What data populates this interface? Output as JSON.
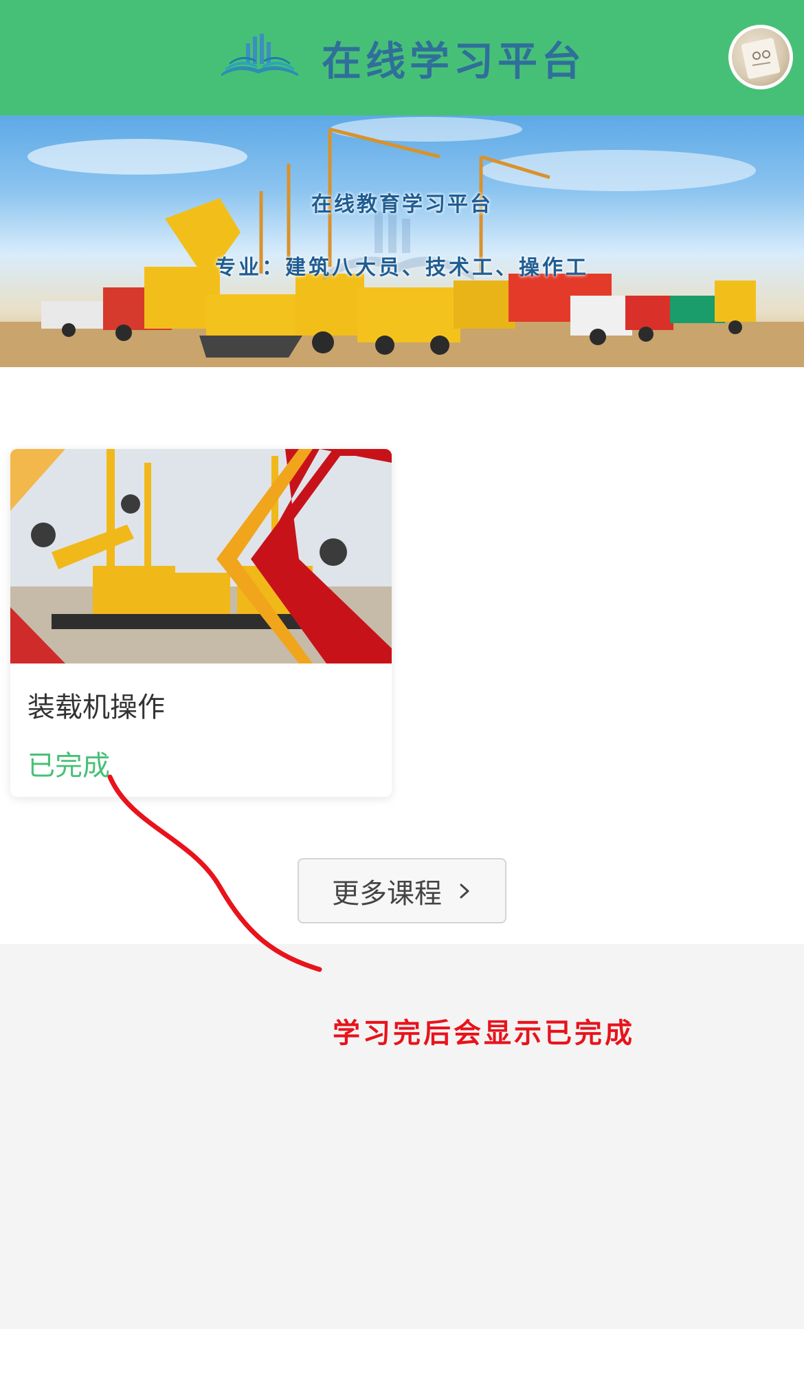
{
  "header": {
    "title": "在线学习平台",
    "brand_color": "#47c077",
    "title_color": "#2f6f9a",
    "logo_icon": "open-book-chart-icon",
    "avatar_icon": "user-avatar"
  },
  "banner": {
    "title": "在线教育学习平台",
    "subtitle": "专业：建筑八大员、技术工、操作工",
    "text_color": "#1f5d92"
  },
  "courses": [
    {
      "name": "装载机操作",
      "status": "已完成",
      "status_color": "#47c077",
      "thumbnail": "construction-machinery-image"
    }
  ],
  "more_button": {
    "label": "更多课程",
    "icon": "chevron-right-icon"
  },
  "annotation": {
    "text": "学习完后会显示已完成",
    "color": "#e8131b"
  }
}
